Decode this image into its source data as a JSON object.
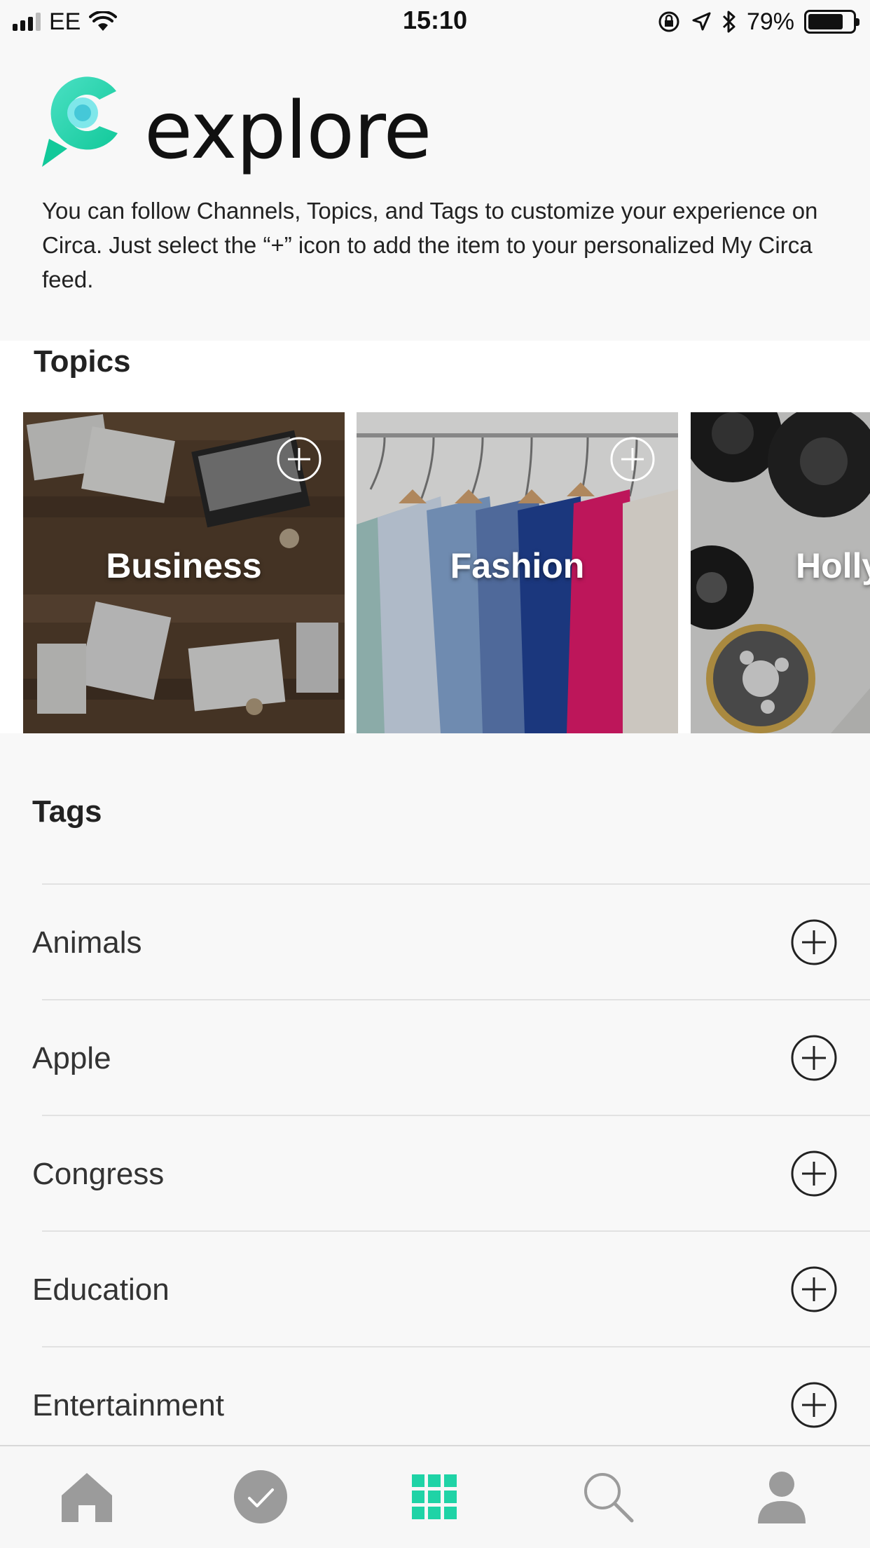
{
  "status_bar": {
    "carrier": "EE",
    "time": "15:10",
    "battery_percent": "79%",
    "battery_level": 0.79,
    "icons": [
      "signal-icon",
      "wifi-icon",
      "orientation-lock-icon",
      "location-icon",
      "bluetooth-icon",
      "battery-icon"
    ]
  },
  "header": {
    "title": "explore",
    "description": "You can follow Channels, Topics, and Tags to customize your experience on Circa. Just select the “+” icon to add the item to your personalized My Circa feed."
  },
  "topics": {
    "title": "Topics",
    "items": [
      {
        "label": "Business"
      },
      {
        "label": "Fashion"
      },
      {
        "label": "Hollyw"
      }
    ]
  },
  "tags": {
    "title": "Tags",
    "items": [
      {
        "label": "Animals"
      },
      {
        "label": "Apple"
      },
      {
        "label": "Congress"
      },
      {
        "label": "Education"
      },
      {
        "label": "Entertainment"
      }
    ]
  },
  "tab_bar": {
    "tabs": [
      "home-icon",
      "check-icon",
      "grid-icon",
      "search-icon",
      "profile-icon"
    ],
    "active": "grid-icon"
  },
  "colors": {
    "brand": "#1fd3a6",
    "brand_light": "#6ee6e0",
    "tab_inactive": "#9b9b9b",
    "background": "#f8f8f8"
  }
}
